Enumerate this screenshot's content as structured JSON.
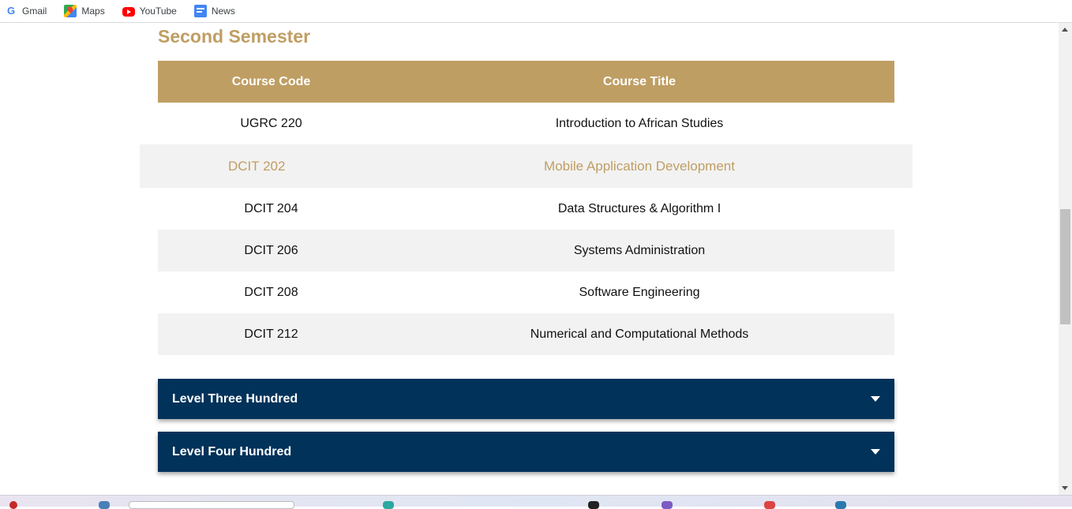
{
  "bookmarks": [
    {
      "label": "Gmail",
      "icon": "google-icon"
    },
    {
      "label": "Maps",
      "icon": "maps-icon"
    },
    {
      "label": "YouTube",
      "icon": "youtube-icon"
    },
    {
      "label": "News",
      "icon": "news-icon"
    }
  ],
  "section": {
    "title": "Second Semester"
  },
  "table": {
    "headers": {
      "code": "Course Code",
      "title": "Course Title"
    },
    "rows": [
      {
        "code": "UGRC 220",
        "title": "Introduction to African Studies"
      },
      {
        "code": "DCIT 202",
        "title": "Mobile Application Development"
      },
      {
        "code": "DCIT 204",
        "title": "Data Structures & Algorithm I"
      },
      {
        "code": "DCIT 206",
        "title": "Systems Administration"
      },
      {
        "code": "DCIT 208",
        "title": "Software Engineering"
      },
      {
        "code": "DCIT 212",
        "title": "Numerical and Computational Methods"
      }
    ]
  },
  "accordions": [
    {
      "label": "Level Three Hundred"
    },
    {
      "label": "Level Four Hundred"
    }
  ],
  "colors": {
    "gold": "#bf9e63",
    "navy": "#01325a",
    "row_alt": "#f2f2f2"
  }
}
